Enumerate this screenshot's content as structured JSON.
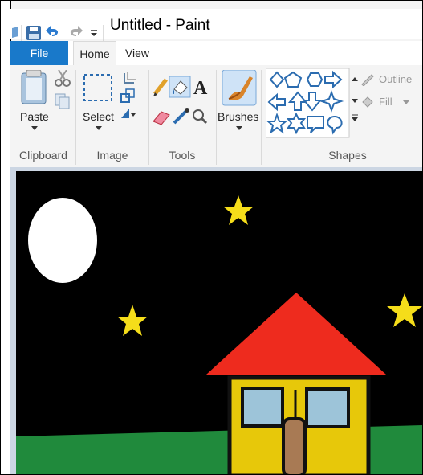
{
  "window": {
    "title": "Untitled - Paint"
  },
  "tabs": {
    "file": "File",
    "home": "Home",
    "view": "View"
  },
  "ribbon": {
    "clipboard": {
      "group_label": "Clipboard",
      "paste_label": "Paste"
    },
    "image": {
      "group_label": "Image",
      "select_label": "Select"
    },
    "tools": {
      "group_label": "Tools"
    },
    "brushes": {
      "label": "Brushes"
    },
    "shapes": {
      "group_label": "Shapes",
      "outline_label": "Outline",
      "fill_label": "Fill"
    }
  },
  "colors": {
    "file_tab": "#1979ca",
    "sky": "#000000",
    "moon": "#ffffff",
    "star": "#f5dd1a",
    "roof": "#ee2b1e",
    "house_wall": "#e7c80a",
    "window": "#9dc4d9",
    "door": "#a87a54",
    "grass": "#208a3c"
  }
}
